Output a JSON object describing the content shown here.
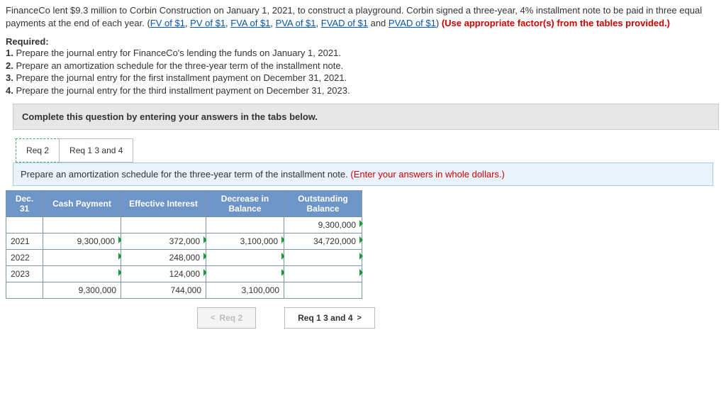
{
  "intro": {
    "line1_before": "FinanceCo lent $9.3 million to Corbin Construction on January 1, 2021, to construct a playground. Corbin signed a three-year, 4% installment note to be paid in three equal payments at the end of each year. (",
    "links": [
      "FV of $1",
      "PV of $1",
      "FVA of $1",
      "PVA of $1",
      "FVAD of $1",
      "PVAD of $1"
    ],
    "sep": ", ",
    "and": " and ",
    "close": ") ",
    "red_note": "(Use appropriate factor(s) from the tables provided.)"
  },
  "required_heading": "Required:",
  "required": [
    {
      "num": "1.",
      "text": " Prepare the journal entry for FinanceCo's lending the funds on January 1, 2021."
    },
    {
      "num": "2.",
      "text": " Prepare an amortization schedule for the three-year term of the installment note."
    },
    {
      "num": "3.",
      "text": " Prepare the journal entry for the first installment payment on December 31, 2021."
    },
    {
      "num": "4.",
      "text": " Prepare the journal entry for the third installment payment on December 31, 2023."
    }
  ],
  "graybox": "Complete this question by entering your answers in the tabs below.",
  "tabs": {
    "t1": "Req 2",
    "t2": "Req 1 3 and 4"
  },
  "desc": {
    "main": "Prepare an amortization schedule for the three-year term of the installment note. ",
    "hint": "(Enter your answers in whole dollars.)"
  },
  "table": {
    "headers": {
      "c0": "Dec. 31",
      "c1": "Cash Payment",
      "c2": "Effective Interest",
      "c3": "Decrease in Balance",
      "c4": "Outstanding Balance"
    },
    "rows": [
      {
        "year": "",
        "cash": "",
        "eff": "",
        "dec": "",
        "out": "9,300,000"
      },
      {
        "year": "2021",
        "cash": "9,300,000",
        "eff": "372,000",
        "dec": "3,100,000",
        "out": "34,720,000"
      },
      {
        "year": "2022",
        "cash": "",
        "eff": "248,000",
        "dec": "",
        "out": ""
      },
      {
        "year": "2023",
        "cash": "",
        "eff": "124,000",
        "dec": "",
        "out": ""
      },
      {
        "year": "",
        "cash": "9,300,000",
        "eff": "744,000",
        "dec": "3,100,000",
        "out": ""
      }
    ]
  },
  "nav": {
    "prev": "Req 2",
    "next": "Req 1 3 and 4"
  }
}
